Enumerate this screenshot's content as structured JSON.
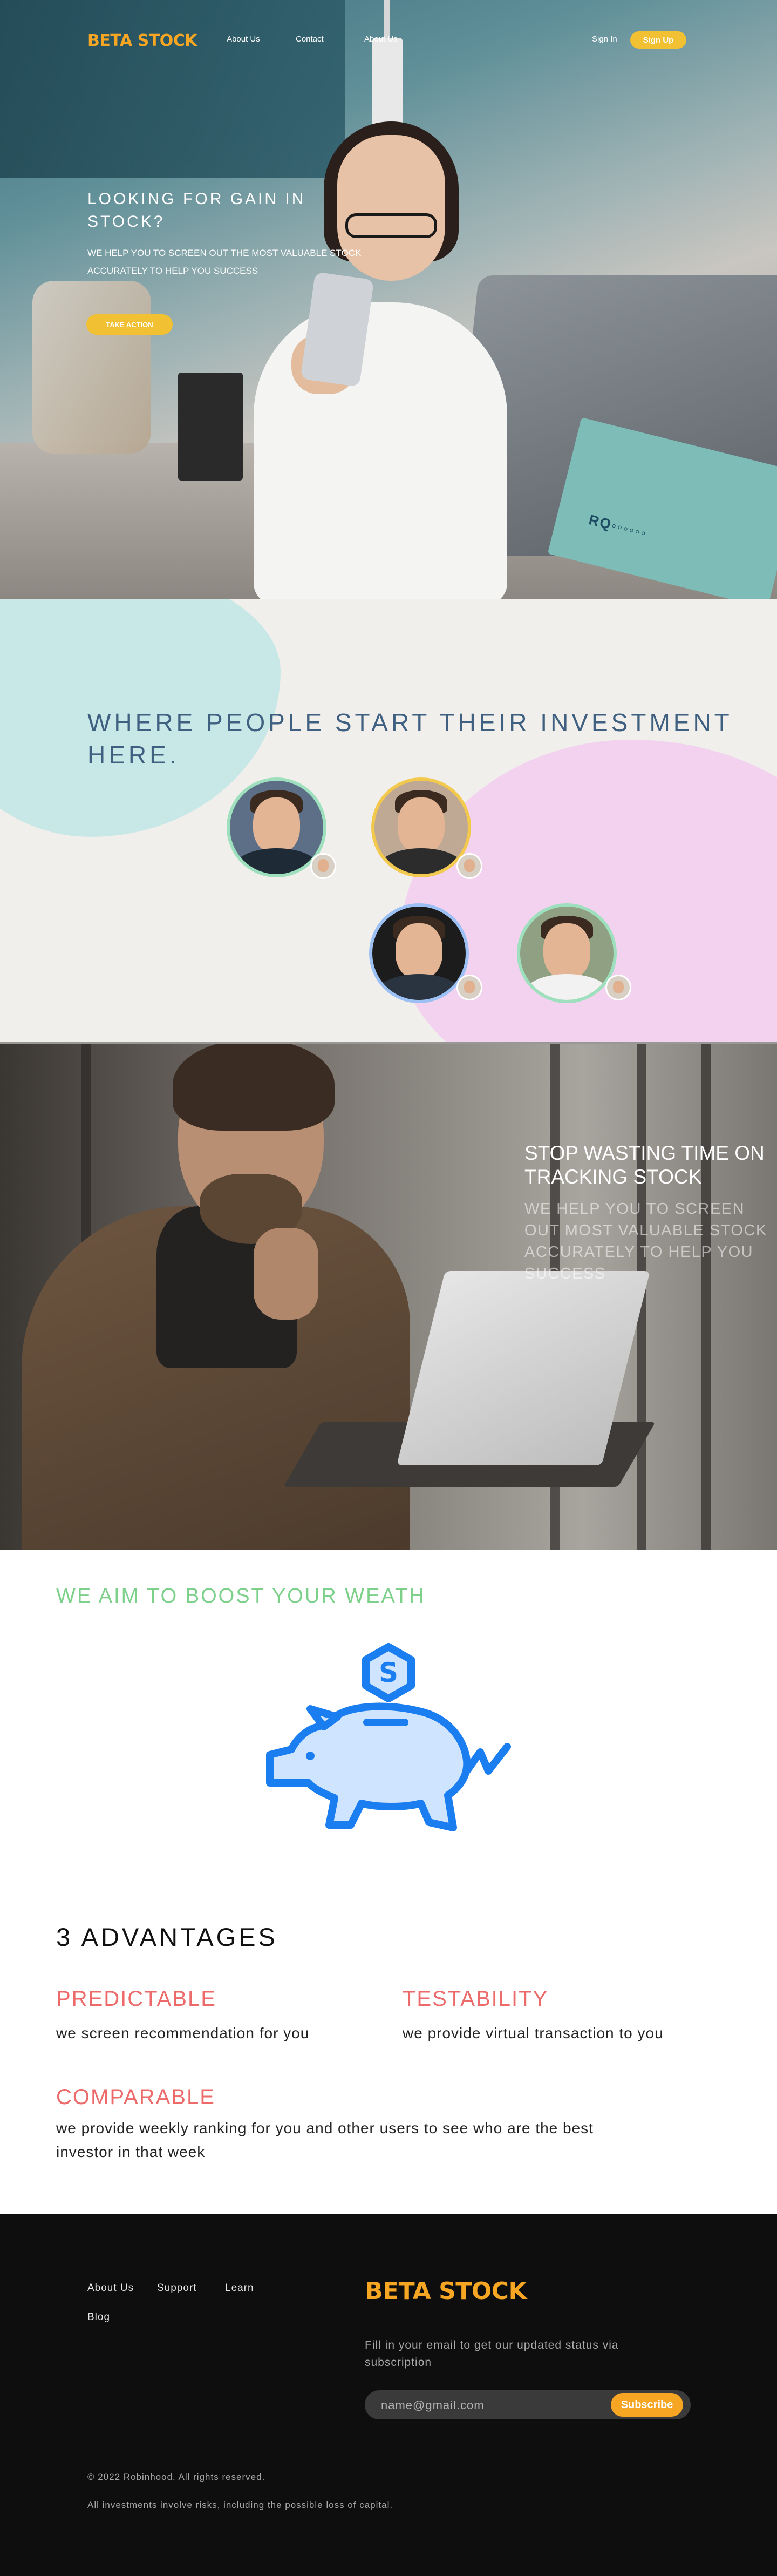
{
  "brand": {
    "name": "BETA STOCK",
    "accent": "#f6a623",
    "button_yellow": "#f2c033"
  },
  "nav": {
    "links": [
      "About Us",
      "Contact",
      "About Us"
    ],
    "sign_in": "Sign In",
    "sign_up": "Sign Up"
  },
  "hero": {
    "headline": "LOOKING FOR GAIN IN STOCK?",
    "subtext": "WE HELP YOU TO SCREEN OUT THE MOST VALUABLE STOCK ACCURATELY TO HELP YOU SUCCESS",
    "cta": "TAKE ACTION"
  },
  "people": {
    "title": "WHERE PEOPLE START THEIR INVESTMENT HERE.",
    "avatars": [
      {
        "icon": "user-avatar",
        "ring": "#9ee0bd"
      },
      {
        "icon": "user-avatar",
        "ring": "#f2c94c"
      },
      {
        "icon": "user-avatar",
        "ring": "#9cc0f4"
      },
      {
        "icon": "user-avatar",
        "ring": "#9ee0bd"
      }
    ]
  },
  "tracking": {
    "title": "STOP WASTING TIME ON TRACKING STOCK",
    "subtext": "WE HELP YOU TO SCREEN OUT MOST VALUABLE STOCK ACCURATELY TO HELP YOU SUCCESS"
  },
  "advantages": {
    "heading": "WE AIM TO BOOST YOUR WEATH",
    "illustration_icon": "piggy-bank-coin-icon",
    "illustration_color": "#1a7df0",
    "count_title": "3 ADVANTAGES",
    "title_color": "#ed6a6a",
    "items": [
      {
        "title": "PREDICTABLE",
        "desc": "we screen recommendation for you"
      },
      {
        "title": "TESTABILITY",
        "desc": "we provide virtual transaction to you"
      },
      {
        "title": "COMPARABLE",
        "desc": "we provide weekly ranking for you and other users to see who are the best investor in that week"
      }
    ]
  },
  "footer": {
    "links": [
      "About Us",
      "Support",
      "Learn",
      "Blog"
    ],
    "logo": "BETA STOCK",
    "subscribe_text": "Fill in your email to get our updated status via subscription",
    "email_placeholder": "name@gmail.com",
    "subscribe_button": "Subscribe",
    "copyright": "© 2022 Robinhood. All rights reserved.",
    "risk": "All investments involve risks, including the possible loss of capital."
  }
}
